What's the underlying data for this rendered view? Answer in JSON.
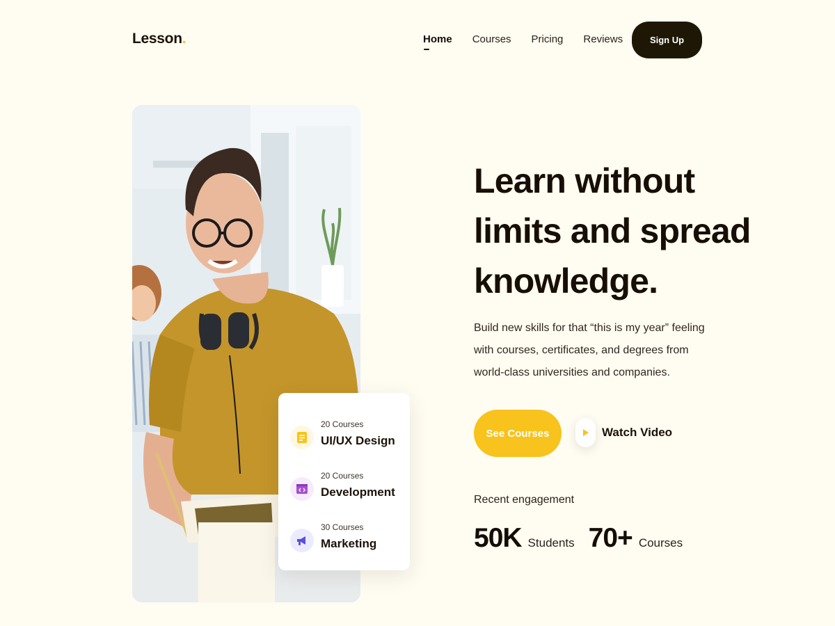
{
  "brand": {
    "name": "Lesson",
    "dot": "."
  },
  "nav": {
    "items": [
      {
        "label": "Home",
        "active": true
      },
      {
        "label": "Courses",
        "active": false
      },
      {
        "label": "Pricing",
        "active": false
      },
      {
        "label": "Reviews",
        "active": false
      }
    ],
    "signup_label": "Sign Up"
  },
  "hero": {
    "headline_lines": [
      "Learn without",
      "limits and spread",
      "knowledge."
    ],
    "description": "Build new skills for that “this is my year” feeling with courses, certificates, and degrees from world-class universities and companies.",
    "cta_primary": "See Courses",
    "cta_secondary": "Watch Video"
  },
  "categories": [
    {
      "count": "20 Courses",
      "name": "UI/UX Design",
      "icon": "document-icon",
      "icon_color": "#f7c31c",
      "icon_bg": "#fff7e0"
    },
    {
      "count": "20 Courses",
      "name": "Development",
      "icon": "code-window-icon",
      "icon_color": "#a64fd1",
      "icon_bg": "#f6eafc"
    },
    {
      "count": "30 Courses",
      "name": "Marketing",
      "icon": "megaphone-icon",
      "icon_color": "#5b4fe0",
      "icon_bg": "#ecebfd"
    }
  ],
  "engagement": {
    "label": "Recent engagement",
    "stats": [
      {
        "value": "50K",
        "label": "Students"
      },
      {
        "value": "70+",
        "label": "Courses"
      }
    ]
  },
  "colors": {
    "background": "#fffcf2",
    "accent": "#f7c31c",
    "dark": "#1f1706"
  }
}
